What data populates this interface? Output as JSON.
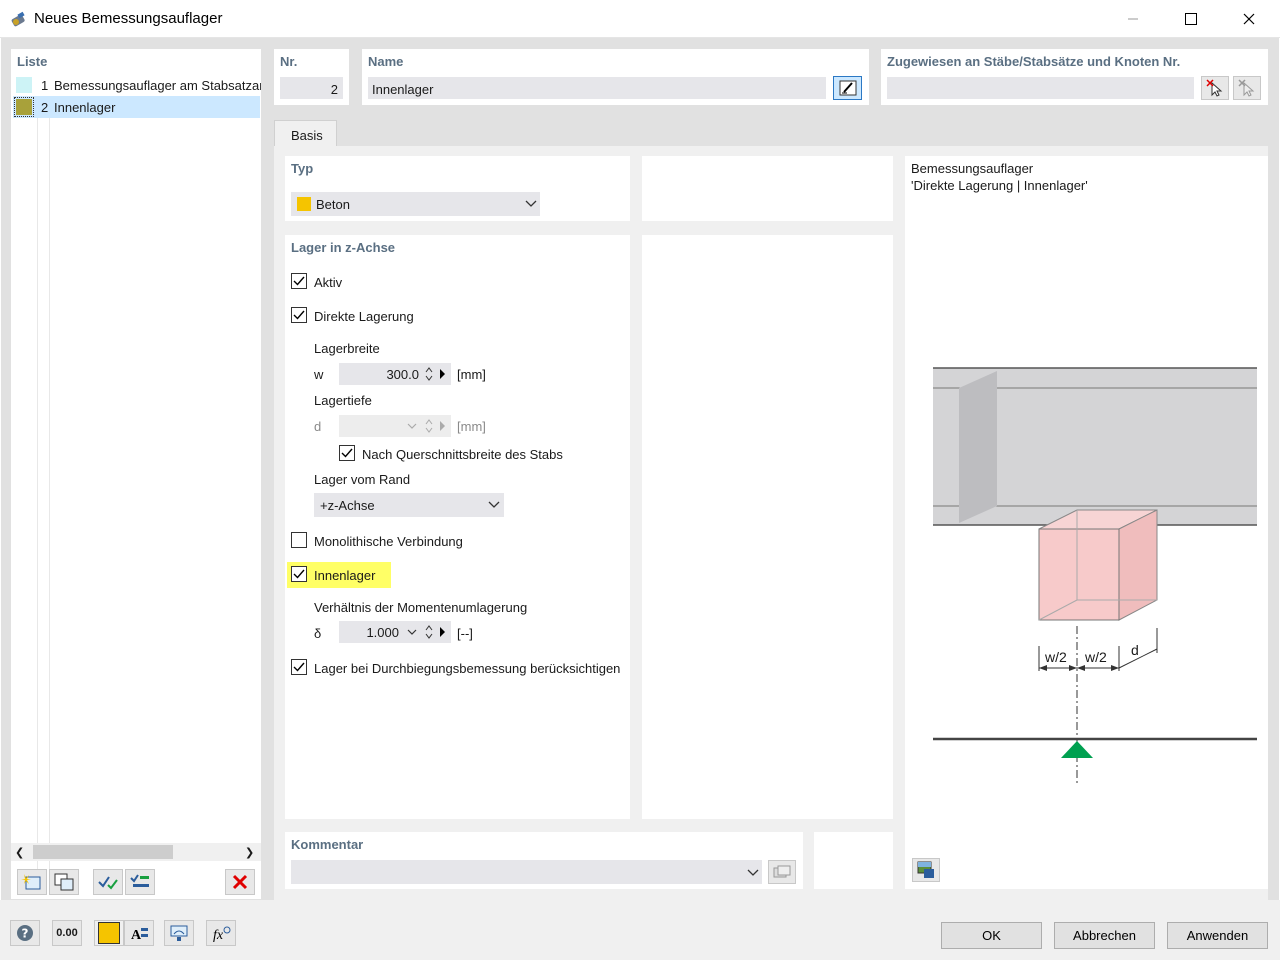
{
  "window": {
    "title": "Neues Bemessungsauflager",
    "minimize": "—",
    "maximize": "☐",
    "close": "✕"
  },
  "list": {
    "header": "Liste",
    "items": [
      {
        "nr": "1",
        "label": "Bemessungsauflager am Stabsatzar",
        "color": "#cdf3f6"
      },
      {
        "nr": "2",
        "label": "Innenlager",
        "color": "#a8a13a",
        "selected": true
      }
    ],
    "toolbar": [
      "new-icon",
      "copy-icon",
      "check-icon",
      "renumber-icon",
      "delete-icon"
    ]
  },
  "nr": {
    "header": "Nr.",
    "value": "2"
  },
  "name": {
    "header": "Name",
    "value": "Innenlager"
  },
  "assigned": {
    "header": "Zugewiesen an Stäbe/Stabsätze und Knoten Nr.",
    "value": ""
  },
  "tabs": [
    {
      "label": "Basis",
      "active": true
    }
  ],
  "typ": {
    "header": "Typ",
    "value": "Beton",
    "color": "#f5c400"
  },
  "lager": {
    "header": "Lager in z-Achse",
    "aktiv": {
      "label": "Aktiv",
      "checked": true
    },
    "direkt": {
      "label": "Direkte Lagerung",
      "checked": true
    },
    "lagerbreite": {
      "label": "Lagerbreite",
      "symbol": "w",
      "value": "300.0",
      "unit": "[mm]"
    },
    "lagertiefe": {
      "label": "Lagertiefe",
      "symbol": "d",
      "value": "",
      "unit": "[mm]"
    },
    "nach_quer": {
      "label": "Nach Querschnittsbreite des Stabs",
      "checked": true
    },
    "vom_rand": {
      "label": "Lager vom Rand",
      "value": "+z-Achse"
    },
    "monolith": {
      "label": "Monolithische Verbindung",
      "checked": false
    },
    "innenlager": {
      "label": "Innenlager",
      "checked": true,
      "highlight": "#ffff66"
    },
    "verhaeltnis": {
      "label": "Verhältnis der Momentenumlagerung",
      "symbol": "δ",
      "value": "1.000",
      "unit": "[--]"
    },
    "durchbiegung": {
      "label": "Lager bei Durchbiegungsbemessung berücksichtigen",
      "checked": true
    }
  },
  "preview": {
    "line1": "Bemessungsauflager",
    "line2": "'Direkte Lagerung | Innenlager'",
    "dim_w1": "w/2",
    "dim_w2": "w/2",
    "dim_d": "d",
    "support_color": "#00a050",
    "block_color": "#f7caca"
  },
  "kommentar": {
    "header": "Kommentar",
    "value": ""
  },
  "bottom_icons": [
    "help-icon",
    "units-icon",
    "color-icon",
    "text-icon",
    "view-icon",
    "formula-icon"
  ],
  "buttons": {
    "ok": "OK",
    "cancel": "Abbrechen",
    "apply": "Anwenden"
  },
  "units_badge": "0.00"
}
